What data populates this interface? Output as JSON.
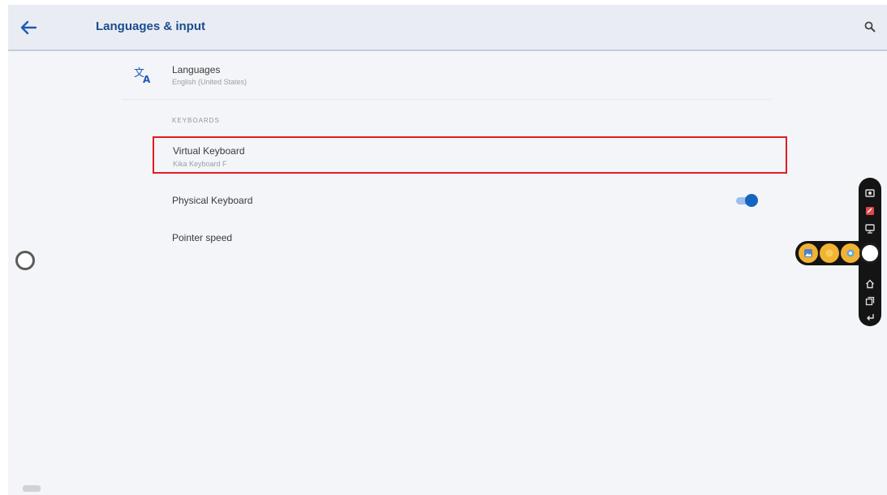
{
  "appbar": {
    "title": "Languages & input"
  },
  "languages": {
    "title": "Languages",
    "subtitle": "English (United States)"
  },
  "keyboards": {
    "header": "KEYBOARDS",
    "virtual": {
      "title": "Virtual Keyboard",
      "subtitle": "Kika Keyboard F"
    },
    "physical": {
      "title": "Physical Keyboard",
      "toggle_on": true
    }
  },
  "pointer_speed": {
    "title": "Pointer speed"
  },
  "colors": {
    "accent": "#1565c0",
    "highlight_border": "#e21b23",
    "appbar_bg": "#e9edf3",
    "toolbar_bg": "#141414",
    "toolbar_button": "#f2b233"
  },
  "icons": {
    "back": "arrow-left-icon",
    "search": "search-icon",
    "languages": "translate-icon"
  }
}
